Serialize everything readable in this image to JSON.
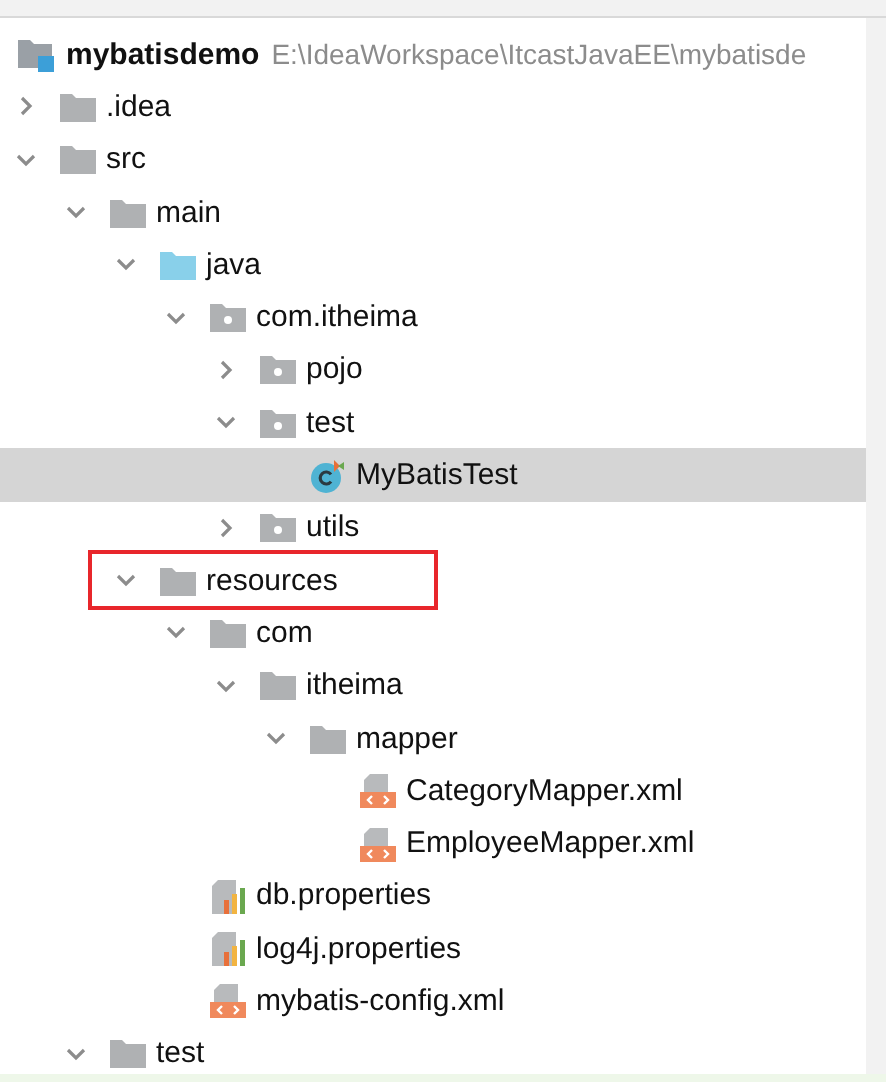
{
  "root": {
    "name": "mybatisdemo",
    "path": "E:\\IdeaWorkspace\\ItcastJavaEE\\mybatisde",
    "children": [
      {
        "name": ".idea",
        "kind": "folder",
        "expanded": false,
        "selected": false
      },
      {
        "name": "src",
        "kind": "folder",
        "expanded": true,
        "selected": false,
        "children": [
          {
            "name": "main",
            "kind": "folder",
            "expanded": true,
            "selected": false,
            "children": [
              {
                "name": "java",
                "kind": "source",
                "expanded": true,
                "selected": false,
                "children": [
                  {
                    "name": "com.itheima",
                    "kind": "package",
                    "expanded": true,
                    "selected": false,
                    "children": [
                      {
                        "name": "pojo",
                        "kind": "package",
                        "expanded": false,
                        "selected": false
                      },
                      {
                        "name": "test",
                        "kind": "package",
                        "expanded": true,
                        "selected": false,
                        "children": [
                          {
                            "name": "MyBatisTest",
                            "kind": "class",
                            "selected": true
                          }
                        ]
                      },
                      {
                        "name": "utils",
                        "kind": "package",
                        "expanded": false,
                        "selected": false
                      }
                    ]
                  }
                ]
              },
              {
                "name": "resources",
                "kind": "folder",
                "expanded": true,
                "selected": false,
                "annotated": true,
                "children": [
                  {
                    "name": "com",
                    "kind": "folder",
                    "expanded": true,
                    "selected": false,
                    "children": [
                      {
                        "name": "itheima",
                        "kind": "folder",
                        "expanded": true,
                        "selected": false,
                        "children": [
                          {
                            "name": "mapper",
                            "kind": "folder",
                            "expanded": true,
                            "selected": false,
                            "children": [
                              {
                                "name": "CategoryMapper.xml",
                                "kind": "xml",
                                "selected": false
                              },
                              {
                                "name": "EmployeeMapper.xml",
                                "kind": "xml",
                                "selected": false
                              }
                            ]
                          }
                        ]
                      }
                    ]
                  },
                  {
                    "name": "db.properties",
                    "kind": "properties",
                    "selected": false
                  },
                  {
                    "name": "log4j.properties",
                    "kind": "properties",
                    "selected": false
                  },
                  {
                    "name": "mybatis-config.xml",
                    "kind": "xml",
                    "selected": false
                  }
                ]
              }
            ]
          },
          {
            "name": "test",
            "kind": "folder",
            "expanded": true,
            "selected": false
          }
        ]
      }
    ]
  }
}
